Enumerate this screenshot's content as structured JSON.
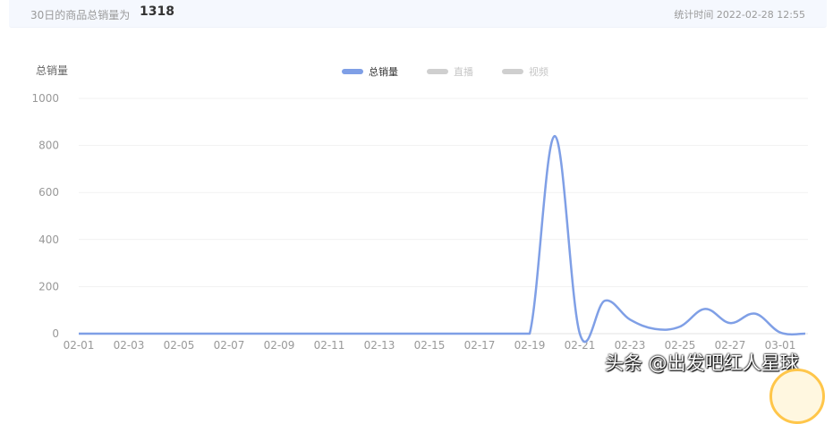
{
  "summary": {
    "label": "30日的商品总销量为",
    "value": "1318",
    "stat_time": "统计时间 2022-02-28 12:55"
  },
  "watermark": "头条 @出发吧红人星球",
  "colors": {
    "total": "#7f9fe6",
    "muted": "#cfcfcf",
    "grid": "#f1f1f1",
    "axis_text": "#999999"
  },
  "chart_data": {
    "type": "line",
    "ylabel": "总销量",
    "ylim": [
      0,
      1000
    ],
    "yticks": [
      0,
      200,
      400,
      600,
      800,
      1000
    ],
    "legend": {
      "placement": "top-center",
      "items": [
        {
          "name": "总销量",
          "active": true
        },
        {
          "name": "直播",
          "active": false
        },
        {
          "name": "视频",
          "active": false
        }
      ]
    },
    "xtick_labels": [
      "02-01",
      "02-03",
      "02-05",
      "02-07",
      "02-09",
      "02-11",
      "02-13",
      "02-15",
      "02-17",
      "02-19",
      "02-21",
      "02-23",
      "02-25",
      "02-27",
      "03-01"
    ],
    "x": [
      "02-01",
      "02-02",
      "02-03",
      "02-04",
      "02-05",
      "02-06",
      "02-07",
      "02-08",
      "02-09",
      "02-10",
      "02-11",
      "02-12",
      "02-13",
      "02-14",
      "02-15",
      "02-16",
      "02-17",
      "02-18",
      "02-19",
      "02-20",
      "02-21",
      "02-22",
      "02-23",
      "02-24",
      "02-25",
      "02-26",
      "02-27",
      "02-28",
      "03-01",
      "03-02"
    ],
    "series": [
      {
        "name": "总销量",
        "values": [
          0,
          0,
          0,
          0,
          0,
          0,
          0,
          0,
          0,
          0,
          0,
          0,
          0,
          0,
          0,
          0,
          0,
          0,
          0,
          840,
          0,
          140,
          60,
          20,
          30,
          105,
          45,
          85,
          5,
          0
        ]
      }
    ]
  }
}
